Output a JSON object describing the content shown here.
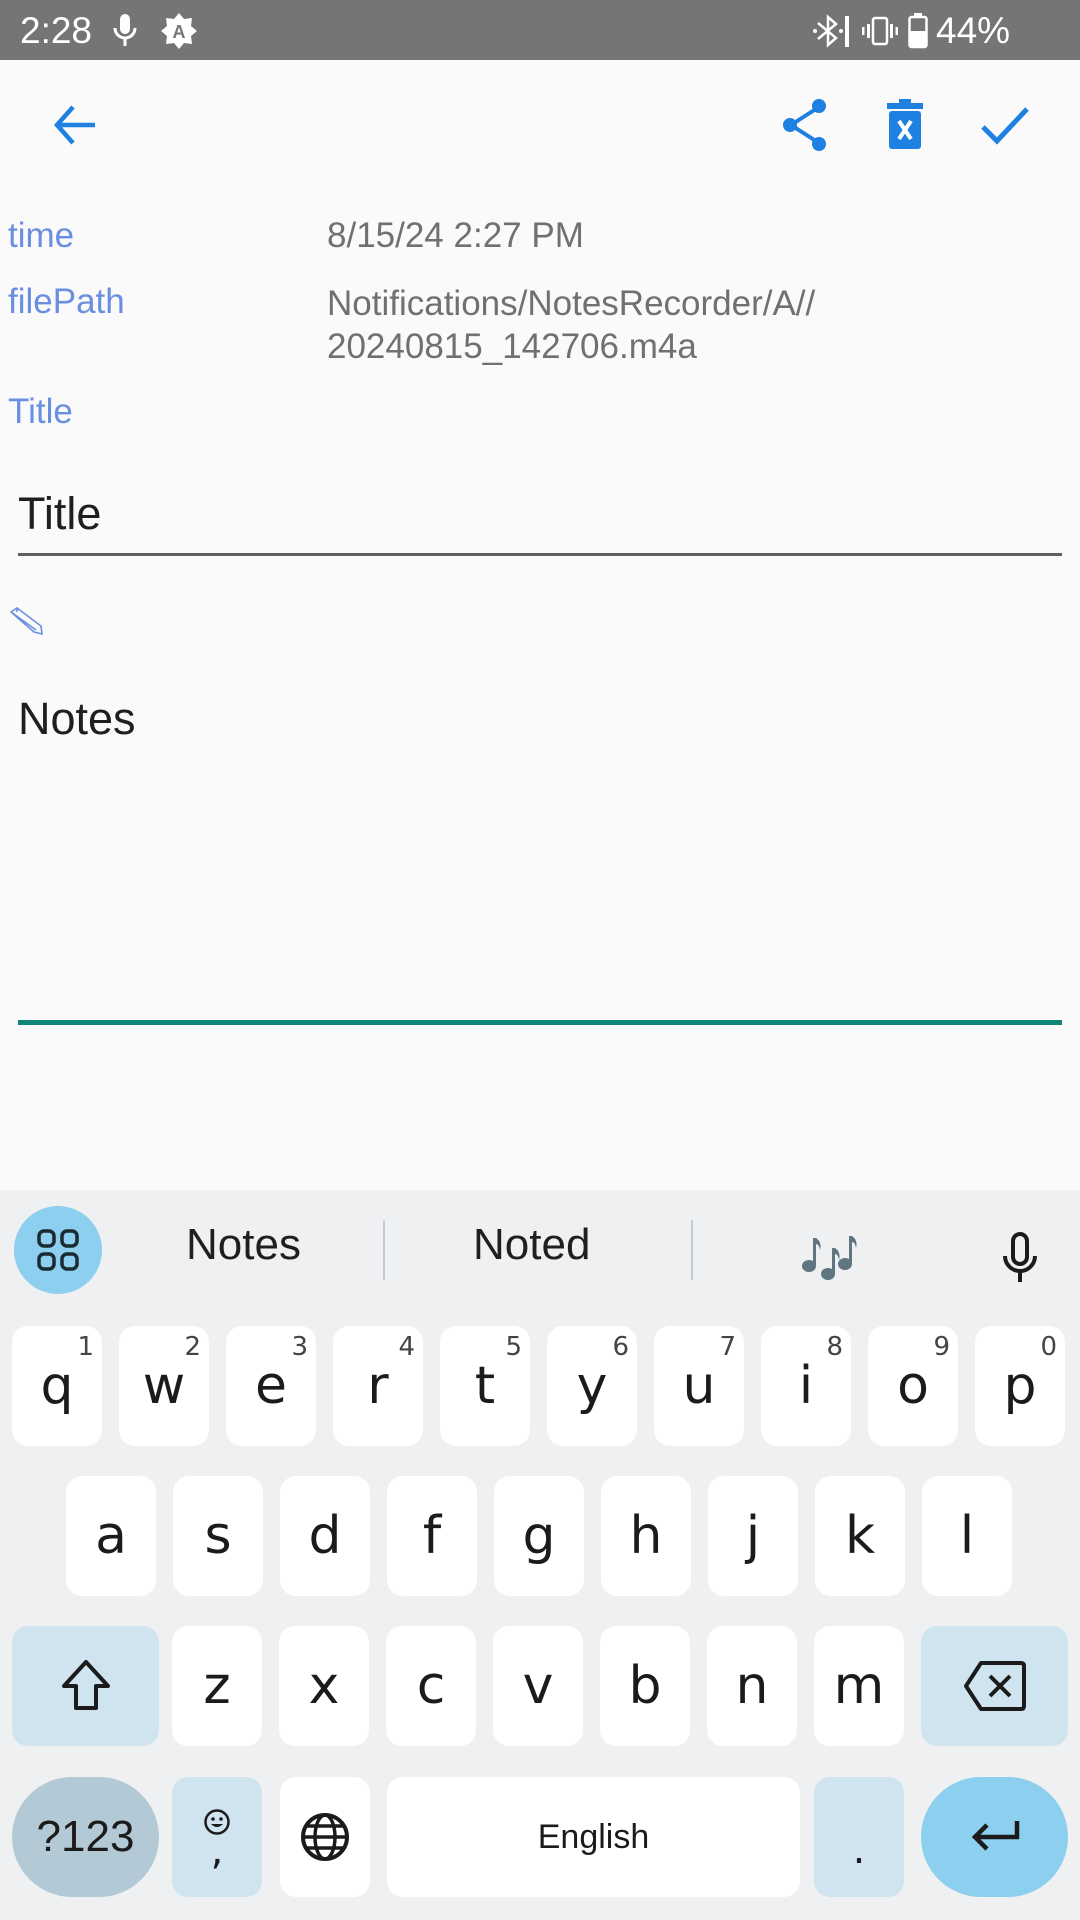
{
  "status_bar": {
    "time": "2:28",
    "left_icons": [
      "microphone-icon",
      "auto-brightness-icon"
    ],
    "right_icons": [
      "bluetooth-icon",
      "vibrate-icon",
      "battery-icon"
    ],
    "battery": "44%"
  },
  "toolbar": {
    "back_icon": "arrow-back-icon",
    "actions": [
      "share-icon",
      "delete-icon",
      "check-icon"
    ],
    "accent_color": "#1e80e0"
  },
  "fields": {
    "time_label": "time",
    "time_value": "8/15/24 2:27 PM",
    "filepath_label": "filePath",
    "filepath_value_line1": "Notifications/NotesRecorder/A//",
    "filepath_value_line2": "20240815_142706.m4a",
    "title_label": "Title"
  },
  "title_input": {
    "placeholder": "Title",
    "value": ""
  },
  "notes_input": {
    "placeholder": "Notes",
    "value": "",
    "focus_color": "#0f8478"
  },
  "keyboard": {
    "suggestions": [
      "Notes",
      "Noted"
    ],
    "suggestion_emoji": "🎶",
    "row1": [
      {
        "k": "q",
        "h": "1"
      },
      {
        "k": "w",
        "h": "2"
      },
      {
        "k": "e",
        "h": "3"
      },
      {
        "k": "r",
        "h": "4"
      },
      {
        "k": "t",
        "h": "5"
      },
      {
        "k": "y",
        "h": "6"
      },
      {
        "k": "u",
        "h": "7"
      },
      {
        "k": "i",
        "h": "8"
      },
      {
        "k": "o",
        "h": "9"
      },
      {
        "k": "p",
        "h": "0"
      }
    ],
    "row2": [
      "a",
      "s",
      "d",
      "f",
      "g",
      "h",
      "j",
      "k",
      "l"
    ],
    "row3": [
      "z",
      "x",
      "c",
      "v",
      "b",
      "n",
      "m"
    ],
    "symbols_label": "?123",
    "comma_label": ",",
    "space_label": "English",
    "period_label": "."
  }
}
